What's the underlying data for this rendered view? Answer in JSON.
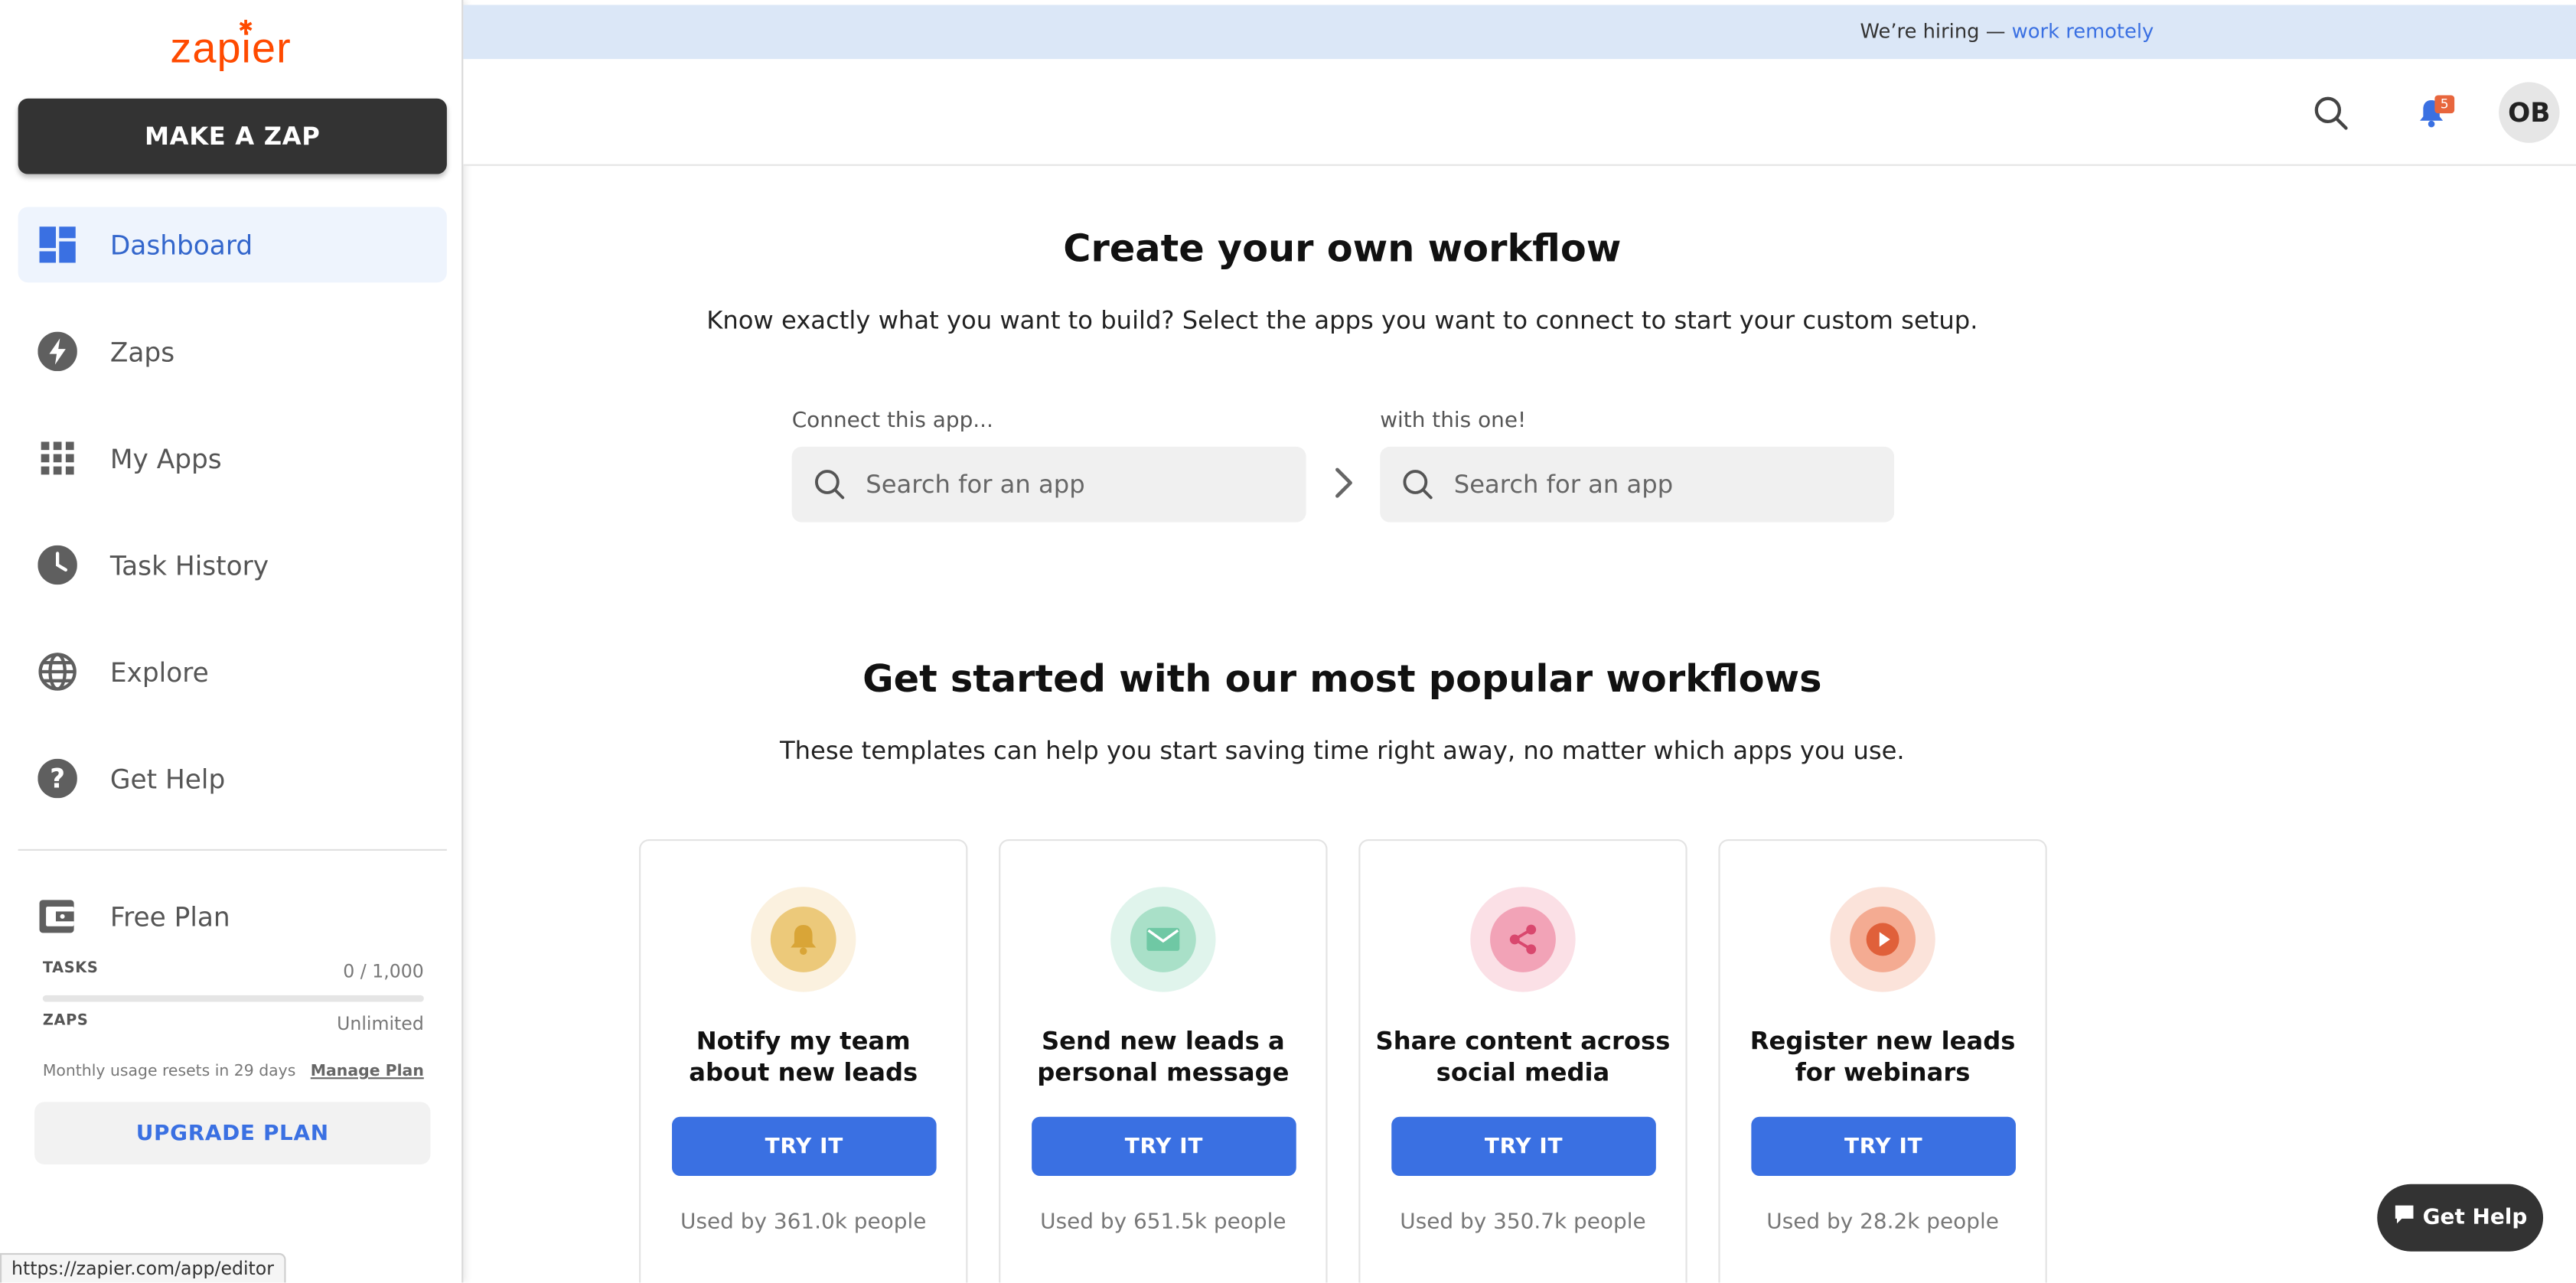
{
  "brand": {
    "logo": "zapier",
    "spark": "✱",
    "logo_color": "#ff4a00"
  },
  "sidebar": {
    "make_zap_label": "MAKE A ZAP",
    "items": [
      {
        "label": "Dashboard",
        "icon": "dashboard-icon",
        "active": true
      },
      {
        "label": "Zaps",
        "icon": "bolt-icon"
      },
      {
        "label": "My Apps",
        "icon": "grid-icon"
      },
      {
        "label": "Task History",
        "icon": "clock-icon"
      },
      {
        "label": "Explore",
        "icon": "globe-icon"
      },
      {
        "label": "Get Help",
        "icon": "help-icon"
      }
    ],
    "plan": {
      "title": "Free Plan",
      "tasks_label": "TASKS",
      "tasks_value": "0 / 1,000",
      "tasks_fraction": 0,
      "zaps_label": "ZAPS",
      "zaps_value": "Unlimited",
      "reset_text": "Monthly usage resets in 29 days",
      "manage_label": "Manage Plan",
      "upgrade_label": "UPGRADE PLAN"
    }
  },
  "banner": {
    "text": "We’re hiring — ",
    "link": "work remotely"
  },
  "header": {
    "notification_count": "5",
    "avatar_initials": "OB"
  },
  "workflow": {
    "title": "Create your own workflow",
    "subtitle": "Know exactly what you want to build? Select the apps you want to connect to start your custom setup.",
    "left_label": "Connect this app...",
    "right_label": "with this one!",
    "placeholder": "Search for an app"
  },
  "popular": {
    "title": "Get started with our most popular workflows",
    "subtitle": "These templates can help you start saving time right away, no matter which apps you use.",
    "try_label": "TRY IT",
    "cards": [
      {
        "line1": "Notify my team",
        "line2": "about new leads",
        "used": "Used by 361.0k people",
        "icon": "bell-icon"
      },
      {
        "line1": "Send new leads a",
        "line2": "personal message",
        "used": "Used by 651.5k people",
        "icon": "mail-icon"
      },
      {
        "line1": "Share content across",
        "line2": "social media",
        "used": "Used by 350.7k people",
        "icon": "share-icon"
      },
      {
        "line1": "Register new leads",
        "line2": "for webinars",
        "used": "Used by 28.2k people",
        "icon": "play-icon"
      }
    ]
  },
  "help_button": "Get Help",
  "status_url": "https://zapier.com/app/editor",
  "colors": {
    "accent": "#3a70e2",
    "dark": "#333333",
    "banner": "#dbe7f7"
  }
}
